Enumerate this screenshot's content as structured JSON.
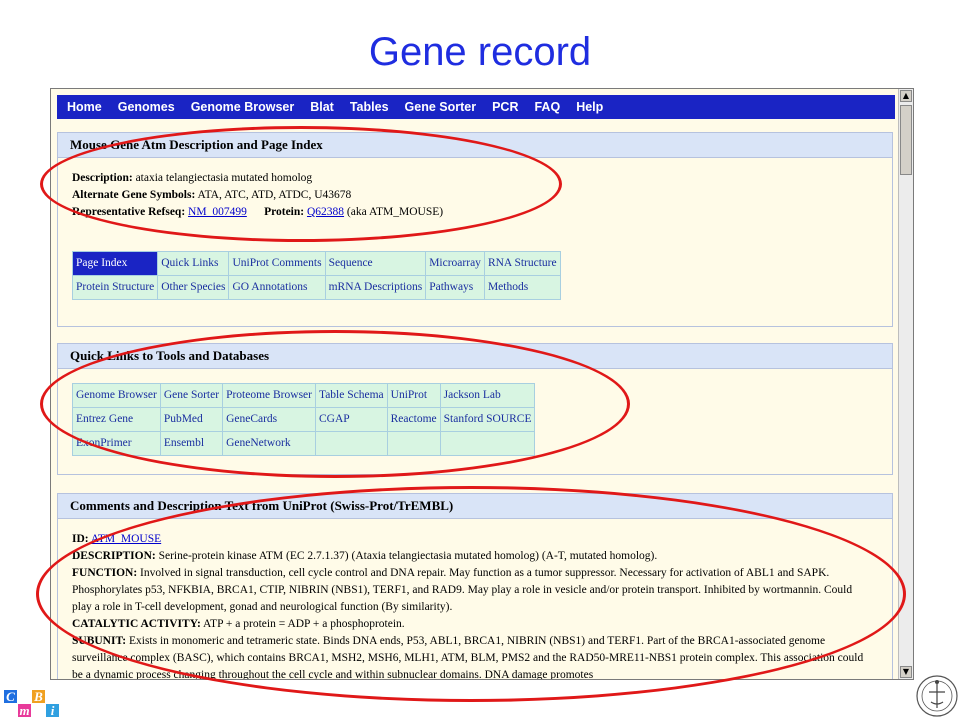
{
  "slide_title": "Gene record",
  "navbar": [
    "Home",
    "Genomes",
    "Genome Browser",
    "Blat",
    "Tables",
    "Gene Sorter",
    "PCR",
    "FAQ",
    "Help"
  ],
  "section1": {
    "header": "Mouse Gene Atm Description and Page Index",
    "description_label": "Description:",
    "description_value": "ataxia telangiectasia mutated homolog",
    "alt_label": "Alternate Gene Symbols:",
    "alt_value": "ATA, ATC, ATD, ATDC, U43678",
    "refseq_label": "Representative Refseq:",
    "refseq_value": "NM_007499",
    "protein_label": "Protein:",
    "protein_value": "Q62388",
    "protein_aka": "(aka ATM_MOUSE)",
    "index_rows": [
      [
        "Page Index",
        "Quick Links",
        "UniProt Comments",
        "Sequence",
        "Microarray",
        "RNA Structure"
      ],
      [
        "Protein Structure",
        "Other Species",
        "GO Annotations",
        "mRNA Descriptions",
        "Pathways",
        "Methods"
      ]
    ]
  },
  "section2": {
    "header": "Quick Links to Tools and Databases",
    "rows": [
      [
        "Genome Browser",
        "Gene Sorter",
        "Proteome Browser",
        "Table Schema",
        "UniProt",
        "Jackson Lab"
      ],
      [
        "Entrez Gene",
        "PubMed",
        "GeneCards",
        "CGAP",
        "Reactome",
        "Stanford SOURCE"
      ],
      [
        "ExonPrimer",
        "Ensembl",
        "GeneNetwork",
        "",
        "",
        ""
      ]
    ]
  },
  "section3": {
    "header": "Comments and Description Text from UniProt (Swiss-Prot/TrEMBL)",
    "id_label": "ID:",
    "id_value": "ATM_MOUSE",
    "desc_label": "DESCRIPTION:",
    "desc_value": "Serine-protein kinase ATM (EC 2.7.1.37) (Ataxia telangiectasia mutated homolog) (A-T, mutated homolog).",
    "function_label": "FUNCTION:",
    "function_value": "Involved in signal transduction, cell cycle control and DNA repair. May function as a tumor suppressor. Necessary for activation of ABL1 and SAPK. Phosphorylates p53, NFKBIA, BRCA1, CTIP, NIBRIN (NBS1), TERF1, and RAD9. May play a role in vesicle and/or protein transport. Inhibited by wortmannin. Could play a role in T-cell development, gonad and neurological function (By similarity).",
    "catalytic_label": "CATALYTIC ACTIVITY:",
    "catalytic_value": "ATP + a protein = ADP + a phosphoprotein.",
    "subunit_label": "SUBUNIT:",
    "subunit_value": "Exists in monomeric and tetrameric state. Binds DNA ends, P53, ABL1, BRCA1, NIBRIN (NBS1) and TERF1. Part of the BRCA1-associated genome surveillance complex (BASC), which contains BRCA1, MSH2, MSH6, MLH1, ATM, BLM, PMS2 and the RAD50-MRE11-NBS1 protein complex. This association could be a dynamic process changing throughout the cell cycle and within subnuclear domains. DNA damage promotes"
  },
  "logo_letters": [
    "C",
    "m",
    "B",
    "i"
  ],
  "colors": {
    "title": "#1f2de0",
    "navbar": "#1a24c4",
    "oval": "#e01818"
  }
}
